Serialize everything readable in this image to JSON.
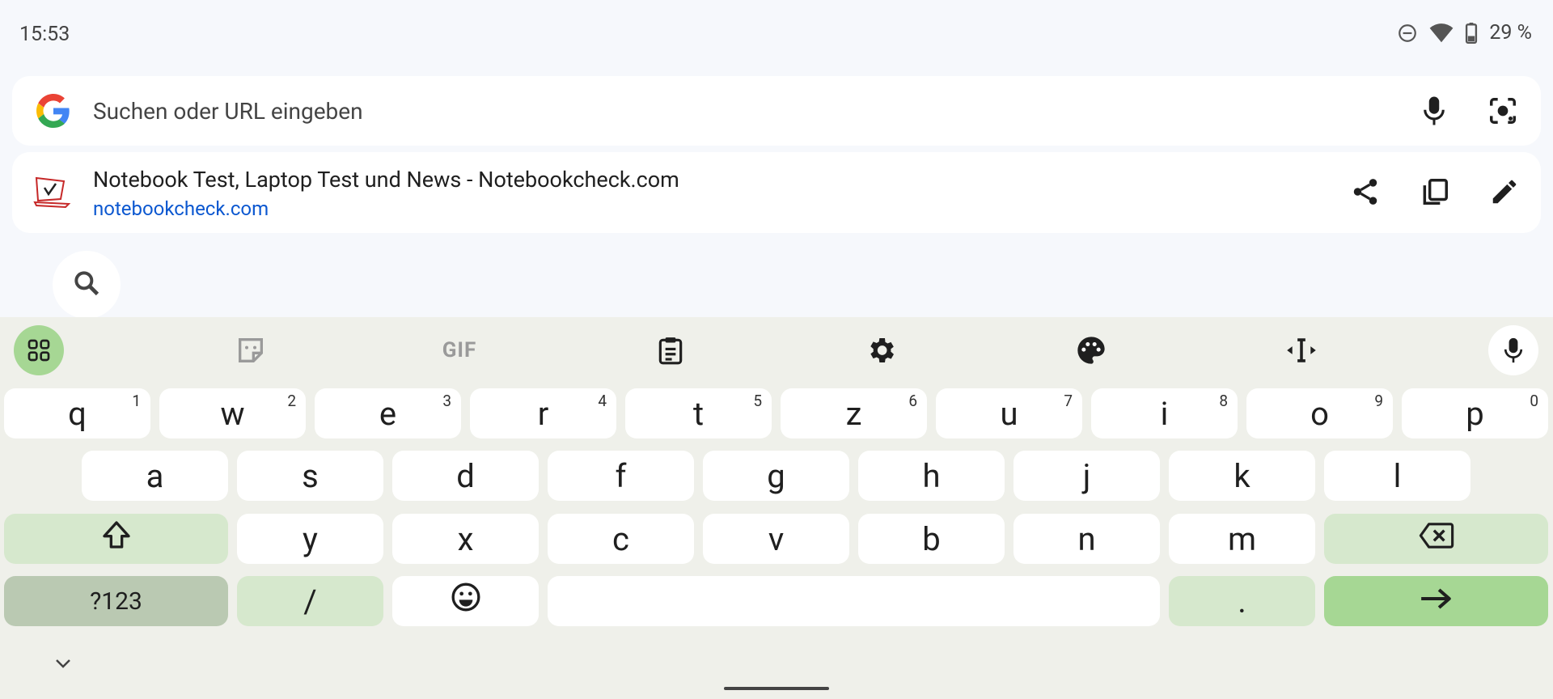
{
  "status_bar": {
    "time": "15:53",
    "battery_text": "29 %",
    "icons": [
      "do-not-disturb-icon",
      "wifi-icon",
      "battery-icon"
    ]
  },
  "search_bar": {
    "placeholder": "Suchen oder URL eingeben",
    "icons": [
      "google-logo",
      "mic-icon",
      "lens-icon"
    ]
  },
  "suggestion": {
    "title": "Notebook Test, Laptop Test und News - Notebookcheck.com",
    "url": "notebookcheck.com",
    "actions": [
      "share-icon",
      "copy-icon",
      "edit-icon"
    ]
  },
  "keyboard": {
    "toolbar": {
      "gif_label": "GIF",
      "icons": [
        "apps-grid-icon",
        "sticker-icon",
        "gif-icon",
        "clipboard-icon",
        "settings-icon",
        "palette-icon",
        "text-cursor-icon",
        "mic-icon"
      ]
    },
    "rows": {
      "row1": [
        {
          "label": "q",
          "hint": "1"
        },
        {
          "label": "w",
          "hint": "2"
        },
        {
          "label": "e",
          "hint": "3"
        },
        {
          "label": "r",
          "hint": "4"
        },
        {
          "label": "t",
          "hint": "5"
        },
        {
          "label": "z",
          "hint": "6"
        },
        {
          "label": "u",
          "hint": "7"
        },
        {
          "label": "i",
          "hint": "8"
        },
        {
          "label": "o",
          "hint": "9"
        },
        {
          "label": "p",
          "hint": "0"
        }
      ],
      "row2": [
        "a",
        "s",
        "d",
        "f",
        "g",
        "h",
        "j",
        "k",
        "l"
      ],
      "row3": [
        "y",
        "x",
        "c",
        "v",
        "b",
        "n",
        "m"
      ],
      "row4": {
        "symbols": "?123",
        "slash": "/",
        "period": "."
      }
    }
  },
  "colors": {
    "background": "#f6f8fc",
    "keyboard_bg": "#eff0ea",
    "accent_green": "#a6d794",
    "mod_green": "#d6e8cd",
    "link_blue": "#0b57d0"
  }
}
